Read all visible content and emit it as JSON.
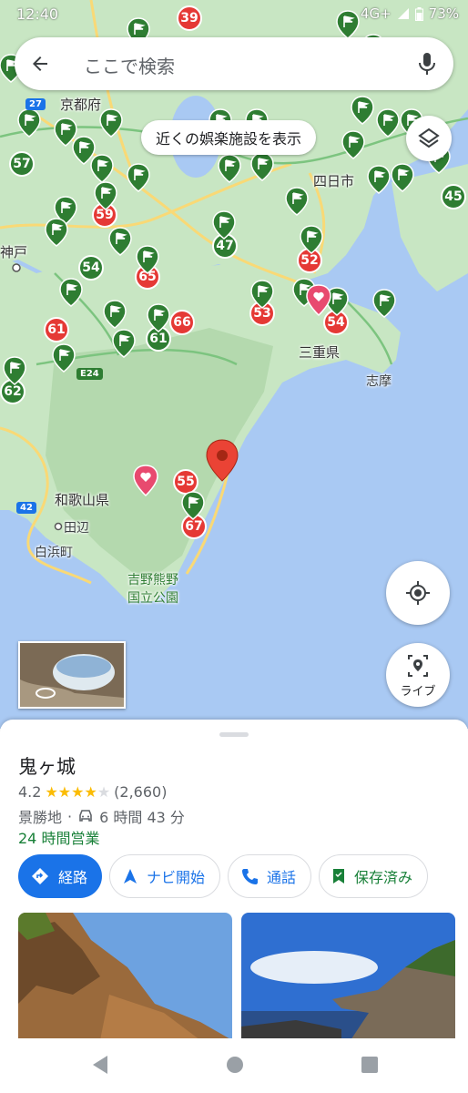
{
  "status_bar": {
    "time": "12:40",
    "network": "4G+",
    "battery": "73%"
  },
  "search": {
    "placeholder": "ここで検索"
  },
  "chip": {
    "label": "近くの娯楽施設を表示"
  },
  "map": {
    "labels": {
      "kyotofu": "京都府",
      "kobe": "神戸",
      "yokkaichi": "四日市",
      "mie": "三重県",
      "shima": "志摩",
      "wakayama": "和歌山県",
      "tanabe": "田辺",
      "shirahama": "白浜町",
      "park_line1": "吉野熊野",
      "park_line2": "国立公園"
    },
    "red_markers": [
      "39",
      "59",
      "65",
      "66",
      "61",
      "53",
      "52",
      "54",
      "55",
      "67"
    ],
    "green_markers": [
      "57",
      "54",
      "47",
      "61",
      "62",
      "45"
    ],
    "road_shields": [
      "27",
      "E24",
      "42"
    ],
    "accent_colors": {
      "water": "#a9c9f3",
      "land": "#c8e6c3",
      "pin_green": "#2e7d32",
      "pin_red": "#e53935"
    }
  },
  "controls": {
    "live_label": "ライブ"
  },
  "place": {
    "name": "鬼ヶ城",
    "rating": "4.2",
    "rating_value": 4.2,
    "reviews": "(2,660)",
    "category": "景勝地",
    "drive_time": "6 時間 43 分",
    "hours": "24 時間営業"
  },
  "actions": {
    "directions": "経路",
    "start": "ナビ開始",
    "call": "通話",
    "saved": "保存済み"
  }
}
